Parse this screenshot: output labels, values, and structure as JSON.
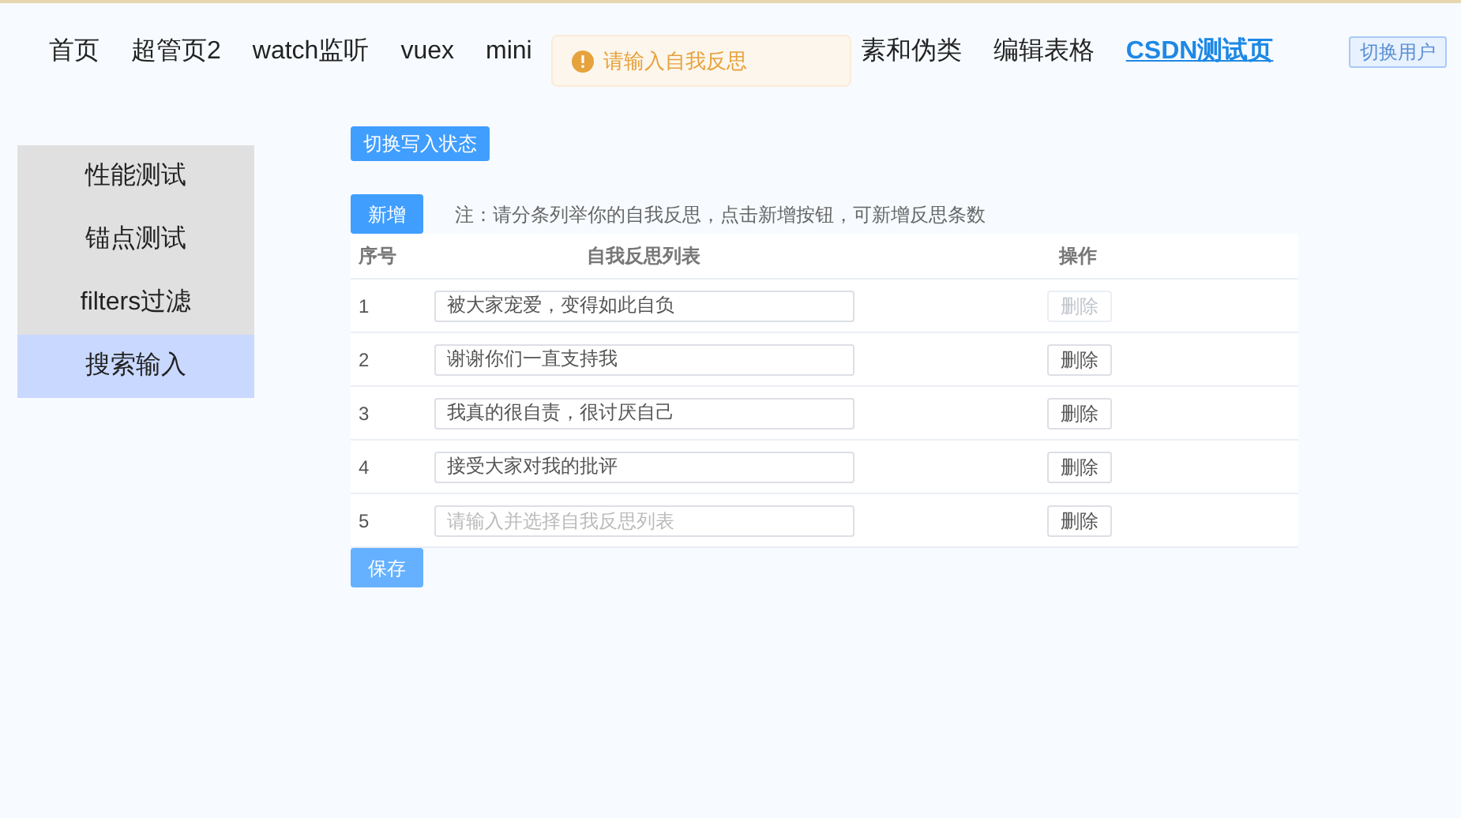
{
  "nav": [
    {
      "label": "首页",
      "selected": false
    },
    {
      "label": "超管页2",
      "selected": false
    },
    {
      "label": "watch监听",
      "selected": false
    },
    {
      "label": "vuex",
      "selected": false
    },
    {
      "label": "mini",
      "selected": false
    },
    {
      "label": "素和伪类",
      "selected": false
    },
    {
      "label": "编辑表格",
      "selected": false
    },
    {
      "label": "CSDN测试页",
      "selected": true
    }
  ],
  "switch_user": "切换用户",
  "toast": {
    "message": "请输入自我反思"
  },
  "sidebar": {
    "items": [
      {
        "label": "性能测试",
        "selected": false
      },
      {
        "label": "锚点测试",
        "selected": false
      },
      {
        "label": "filters过滤",
        "selected": false
      },
      {
        "label": "搜索输入",
        "selected": true
      }
    ]
  },
  "toggle_button": "切换写入状态",
  "add_button": "新增",
  "note": "注：请分条列举你的自我反思，点击新增按钮，可新增反思条数",
  "table": {
    "columns": [
      "序号",
      "自我反思列表",
      "操作"
    ],
    "rows": [
      {
        "index": "1",
        "value": "被大家宠爱，变得如此自负",
        "delete": "删除",
        "delete_disabled": true
      },
      {
        "index": "2",
        "value": "谢谢你们一直支持我",
        "delete": "删除",
        "delete_disabled": false
      },
      {
        "index": "3",
        "value": "我真的很自责，很讨厌自己",
        "delete": "删除",
        "delete_disabled": false
      },
      {
        "index": "4",
        "value": "接受大家对我的批评",
        "delete": "删除",
        "delete_disabled": false
      },
      {
        "index": "5",
        "placeholder": "请输入并选择自我反思列表",
        "delete": "删除",
        "delete_disabled": false
      }
    ]
  },
  "save_button": {
    "label": "保存",
    "disabled": true
  }
}
